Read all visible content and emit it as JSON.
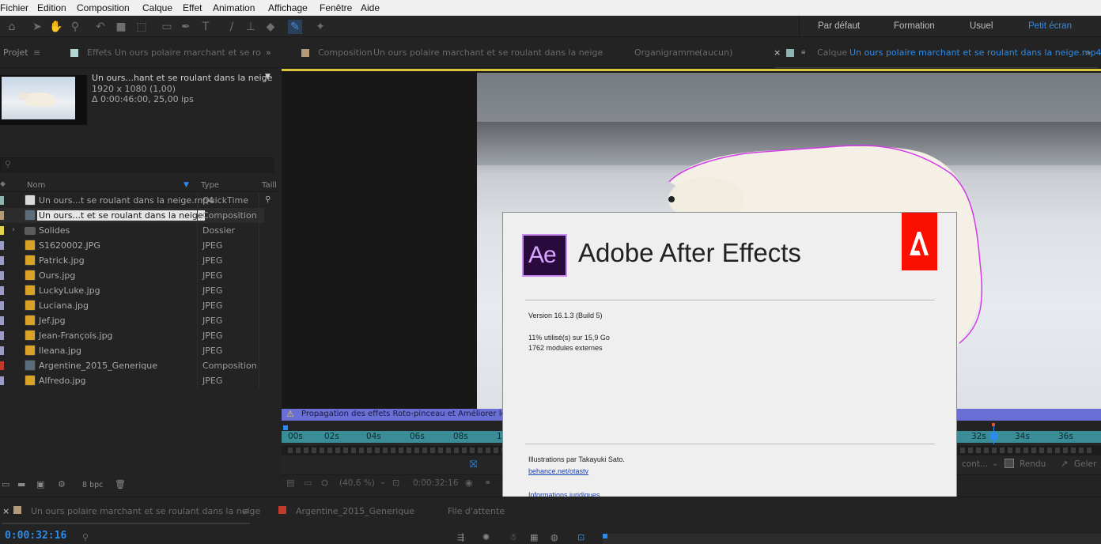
{
  "menu": [
    "Fichier",
    "Edition",
    "Composition",
    "Calque",
    "Effet",
    "Animation",
    "Affichage",
    "Fenêtre",
    "Aide"
  ],
  "workspaces": {
    "default": "Par défaut",
    "training": "Formation",
    "usual": "Usuel",
    "small_screen": "Petit écran"
  },
  "tabs": {
    "project": "Projet",
    "effects": "Effets",
    "effects_target": "Un ours polaire marchant et se ro",
    "composition": "Composition",
    "composition_name": "Un ours polaire marchant et se roulant dans la neige",
    "flowchart": "Organigramme",
    "flowchart_value": "(aucun)",
    "layer": "Calque",
    "layer_name": "Un ours polaire marchant et se roulant dans la neige.mp4"
  },
  "project": {
    "preview_name": "Un ours...hant et se roulant dans la neige",
    "preview_res": "1920 x 1080 (1,00)",
    "preview_duration": "Δ 0:00:46:00, 25,00 ips",
    "search_placeholder": "",
    "col_name": "Nom",
    "col_type": "Type",
    "col_size": "Taill",
    "items": [
      {
        "name": "Un ours...t se roulant dans la neige.mp4",
        "type": "QuickTime",
        "label": "#8fb3b0",
        "icon": "quicktime-icon"
      },
      {
        "name": "Un ours...t et se roulant dans la neige",
        "type": "Composition",
        "label": "#b59a7a",
        "icon": "composition-icon"
      },
      {
        "name": "Solides",
        "type": "Dossier",
        "label": "#e3d54b",
        "icon": "folder-icon"
      },
      {
        "name": "S1620002.JPG",
        "type": "JPEG",
        "label": "#9b9bc4",
        "icon": "image-icon"
      },
      {
        "name": "Patrick.jpg",
        "type": "JPEG",
        "label": "#9b9bc4",
        "icon": "image-icon"
      },
      {
        "name": "Ours.jpg",
        "type": "JPEG",
        "label": "#9b9bc4",
        "icon": "image-icon"
      },
      {
        "name": "LuckyLuke.jpg",
        "type": "JPEG",
        "label": "#9b9bc4",
        "icon": "image-icon"
      },
      {
        "name": "Luciana.jpg",
        "type": "JPEG",
        "label": "#9b9bc4",
        "icon": "image-icon"
      },
      {
        "name": "Jef.jpg",
        "type": "JPEG",
        "label": "#9b9bc4",
        "icon": "image-icon"
      },
      {
        "name": "Jean-François.jpg",
        "type": "JPEG",
        "label": "#9b9bc4",
        "icon": "image-icon"
      },
      {
        "name": "Ileana.jpg",
        "type": "JPEG",
        "label": "#9b9bc4",
        "icon": "image-icon"
      },
      {
        "name": "Argentine_2015_Generique",
        "type": "Composition",
        "label": "#c0392b",
        "icon": "composition-icon"
      },
      {
        "name": "Alfredo.jpg",
        "type": "JPEG",
        "label": "#9b9bc4",
        "icon": "image-icon"
      }
    ],
    "bpc": "8 bpc"
  },
  "viewer": {
    "warning": "Propagation des effets Roto-pinceau et Améliorer le conto",
    "ruler_ticks": [
      "00s",
      "02s",
      "04s",
      "06s",
      "08s",
      "1(",
      "32s",
      "34s",
      "36s"
    ],
    "zoom": "(40,6 %)",
    "timecode": "0:00:32:16",
    "render": "Rendu",
    "freeze": "Geler",
    "cont": "cont..."
  },
  "about": {
    "logo_text": "Ae",
    "title": "Adobe After Effects",
    "version": "Version 16.1.3 (Build 5)",
    "memory": "11% utilisé(s) sur 15,9 Go",
    "modules": "1762 modules externes",
    "illustrations": "Illustrations par Takayuki Sato.",
    "behance": "behance.net/otastv",
    "legal": "Informations juridiques"
  },
  "bottom": {
    "tab1": "Un ours polaire marchant et se roulant dans la neige",
    "tab2": "Argentine_2015_Generique",
    "tab3": "File d'attente",
    "timecode": "0:00:32:16"
  },
  "colors": {
    "accent": "#2d8ceb",
    "adobe_red": "#fa0f00",
    "ae_purple": "#2a0a3d",
    "ae_text": "#d8a6ff"
  }
}
